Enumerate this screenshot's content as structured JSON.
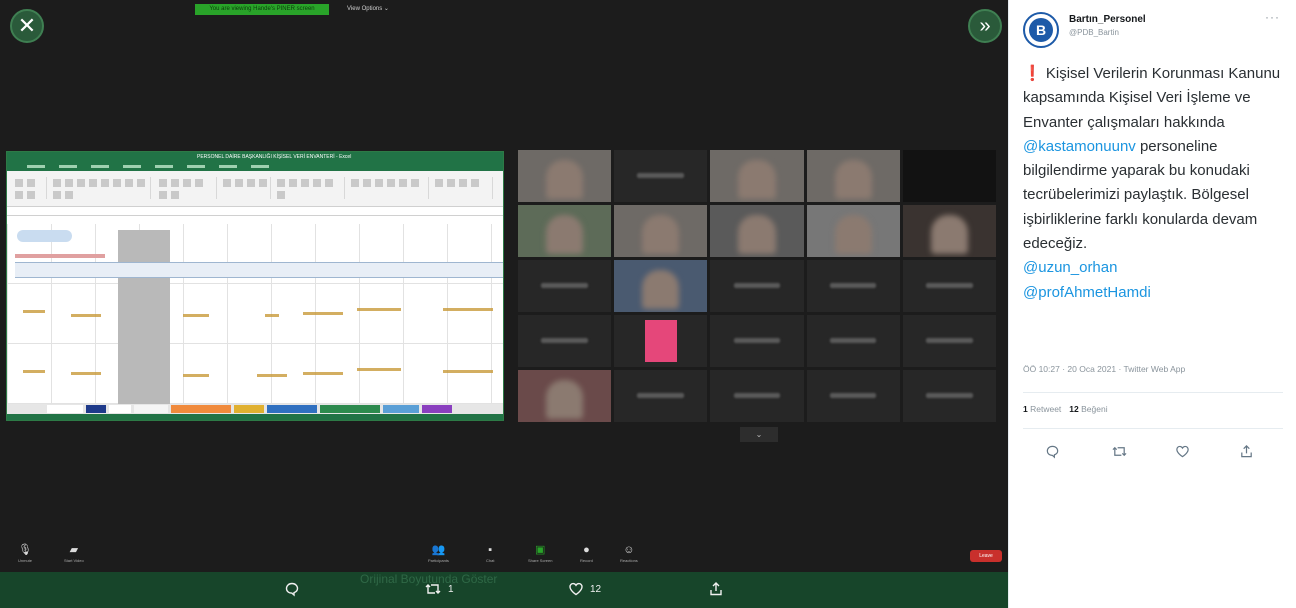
{
  "viewer": {
    "close_glyph": "✕",
    "collapse_glyph": "»",
    "prev_glyph": "←",
    "top_banner": "You are viewing Hande's PINER screen",
    "view_options": "View Options ⌄",
    "gallery_pager": "⌄"
  },
  "excel": {
    "title": "PERSONEL DAİRE BAŞKANLIĞI KİŞİSEL VERİ ENVANTERİ - Excel"
  },
  "zoom_toolbar": {
    "unmute": "Unmute",
    "start_video": "Start Video",
    "participants": "Participants",
    "chat": "Chat",
    "share_screen": "Share Screen",
    "record": "Record",
    "reactions": "Reactions",
    "leave": "Leave"
  },
  "actions_bar": {
    "retweet_count": "1",
    "like_count": "12",
    "watermark": "Orijinal Boyutunda Göster"
  },
  "tweet": {
    "display_name": "Bartın_Personel",
    "handle": "@PDB_Bartin",
    "warning_glyph": "❗",
    "body_part1": " Kişisel Verilerin Korunması Kanunu kapsamında Kişisel Veri İşleme ve Envanter çalışmaları hakkında",
    "mention_1": "@kastamonuunv",
    "body_part2": " personeline bilgilendirme yaparak bu konudaki tecrübelerimizi paylaştık. Bölgesel işbirliklerine farklı konularda devam edeceğiz.",
    "mention_2": "@uzun_orhan",
    "mention_3": "@profAhmetHamdi",
    "meta": "ÖÖ 10:27 · 20 Oca 2021 · Twitter Web App",
    "retweet_count": "1",
    "retweet_label": "Retweet",
    "like_count": "12",
    "like_label": "Beğeni"
  },
  "colors": {
    "viewer_bg": "#1c1c1c",
    "action_bar_bg": "#17452a",
    "mention": "#1b95e0",
    "zoom_green": "#29a329",
    "leave_red": "#c9302c"
  }
}
